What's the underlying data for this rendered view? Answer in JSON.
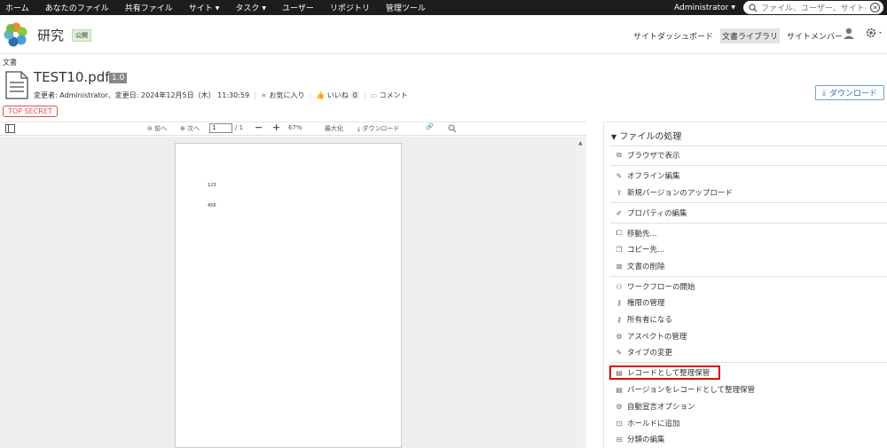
{
  "topnav": {
    "items": [
      "ホーム",
      "あなたのファイル",
      "共有ファイル",
      "サイト",
      "タスク",
      "ユーザー",
      "リポジトリ",
      "管理ツール"
    ],
    "user": "Administrator",
    "search_placeholder": "ファイル、ユーザー、サイトの"
  },
  "header": {
    "site_name": "研究",
    "visibility_badge": "公開",
    "nav": [
      "サイトダッシュボード",
      "文書ライブラリ",
      "サイトメンバー"
    ]
  },
  "breadcrumb": "文書",
  "document": {
    "title": "TEST10.pdf",
    "version": "1.0",
    "modified": "変更者: Administrator、変更日: 2024年12月5日（木） 11:30:59",
    "favorite": "お気に入り",
    "like": "いいね",
    "like_count": "0",
    "comment": "コメント",
    "download": "ダウンロード",
    "tag": "TOP SECRET"
  },
  "viewer": {
    "prev": "前へ",
    "next": "次へ",
    "page": "1",
    "page_total": "/ 1",
    "zoom": "67%",
    "maximize": "最大化",
    "download": "ダウンロード",
    "page_text": [
      "123",
      "456"
    ]
  },
  "panel": {
    "title": "ファイルの処理",
    "actions": [
      "ブラウザで表示",
      "オフライン編集",
      "新規バージョンのアップロード",
      "プロパティの編集",
      "移動先...",
      "コピー先...",
      "文書の削除",
      "ワークフローの開始",
      "権限の管理",
      "所有者になる",
      "アスペクトの管理",
      "タイプの変更",
      "レコードとして整理保管",
      "バージョンをレコードとして整理保管",
      "自動宣言オプション",
      "ホールドに追加",
      "分類の編集"
    ]
  }
}
